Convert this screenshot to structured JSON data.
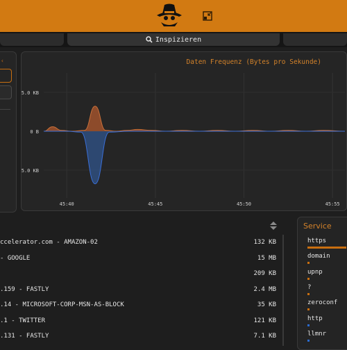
{
  "header": {
    "logo_icon": "spy-hat-logo-icon",
    "shrink_icon": "shrink-window-icon"
  },
  "tabs": {
    "main_label": "Inspizieren",
    "main_icon": "magnifier-icon"
  },
  "chart_data": {
    "type": "area",
    "title": "Daten Frequenz (Bytes pro Sekunde)",
    "y_ticks": [
      "5.0 KB",
      "0 B",
      "5.0 KB"
    ],
    "x_ticks": [
      "45:40",
      "45:45",
      "45:50",
      "45:55"
    ],
    "ylim": [
      -6.5,
      6.5
    ],
    "x_domain": [
      38.7,
      55.7
    ],
    "series": [
      {
        "color": "#a0522d",
        "x": [
          38.7,
          39.2,
          39.7,
          40.3,
          41.0,
          41.6,
          42.2,
          42.8,
          43.4,
          44.0,
          44.8,
          45.6,
          46.5,
          47.5,
          48.5,
          49.5,
          50.5,
          51.5,
          52.5,
          53.5,
          54.5,
          55.7
        ],
        "values": [
          0.0,
          0.5,
          0.1,
          0.0,
          0.1,
          2.8,
          0.1,
          0.0,
          0.1,
          0.2,
          0.1,
          0.0,
          0.1,
          0.0,
          0.1,
          0.0,
          0.1,
          0.0,
          0.1,
          0.0,
          0.1,
          0.0
        ]
      },
      {
        "color": "#2f4f7f",
        "x": [
          38.7,
          40.0,
          40.8,
          41.6,
          42.4,
          43.5,
          55.7
        ],
        "values": [
          0.0,
          0.0,
          -0.1,
          -6.0,
          -0.1,
          0.0,
          0.0
        ]
      }
    ],
    "grid": true
  },
  "table": {
    "rows": [
      {
        "host": "ccelerator.com - AMAZON-02",
        "size": "132 KB"
      },
      {
        "host": "- GOOGLE",
        "size": "15 MB"
      },
      {
        "host": "",
        "size": "209 KB"
      },
      {
        "host": ".159 - FASTLY",
        "size": "2.4 MB"
      },
      {
        "host": ".14 - MICROSOFT-CORP-MSN-AS-BLOCK",
        "size": "35 KB"
      },
      {
        "host": ".1 - TWITTER",
        "size": "121 KB"
      },
      {
        "host": ".131 - FASTLY",
        "size": "7.1 KB"
      }
    ],
    "sort_icon": "sort-updown-icon"
  },
  "services": {
    "title": "Service",
    "items": [
      {
        "name": "https",
        "bar_color": "#c96f10",
        "share": 1.0
      },
      {
        "name": "domain",
        "bar_color": "#c96f10",
        "share": 0.05
      },
      {
        "name": "upnp",
        "bar_color": "#c96f10",
        "share": 0.05
      },
      {
        "name": "?",
        "bar_color": "#c96f10",
        "share": 0.05
      },
      {
        "name": "zeroconf",
        "bar_color": "#c96f10",
        "share": 0.03
      },
      {
        "name": "http",
        "bar_color": "#2a6bd1",
        "share": 0.03
      },
      {
        "name": "llmnr",
        "bar_color": "#2a6bd1",
        "share": 0.03
      }
    ]
  }
}
